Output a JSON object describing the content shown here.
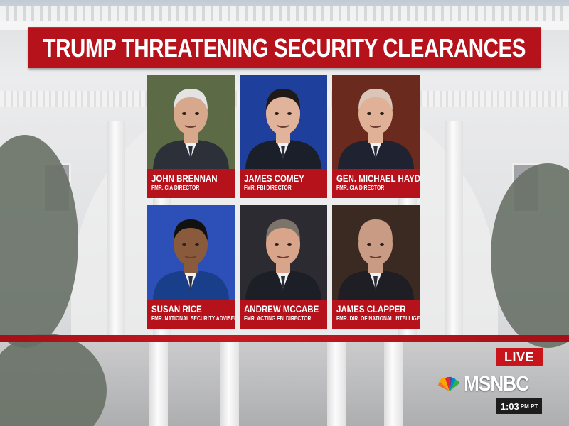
{
  "banner": {
    "headline": "TRUMP THREATENING SECURITY CLEARANCES"
  },
  "cards": [
    {
      "name": "JOHN BRENNAN",
      "title": "FMR. CIA DIRECTOR",
      "bg": "#5c6b45",
      "suit": "#2c3038",
      "skin": "#d7a88c",
      "hair": "#e3e3e3"
    },
    {
      "name": "JAMES COMEY",
      "title": "FMR. FBI DIRECTOR",
      "bg": "#1e3f9c",
      "suit": "#1b1f2a",
      "skin": "#e2b39b",
      "hair": "#1f1a18"
    },
    {
      "name": "GEN. MICHAEL HAYDEN",
      "title": "FMR. CIA DIRECTOR",
      "bg": "#6a2a1d",
      "suit": "#1f2230",
      "skin": "#e0b197",
      "hair": "#d9c6b8"
    },
    {
      "name": "SUSAN RICE",
      "title": "FMR. NATIONAL SECURITY ADVISER",
      "bg": "#2d4fb8",
      "suit": "#1a3f8a",
      "skin": "#8a5a3d",
      "hair": "#111111"
    },
    {
      "name": "ANDREW MCCABE",
      "title": "FMR. ACTING FBI DIRECTOR",
      "bg": "#2b2b31",
      "suit": "#1c1f26",
      "skin": "#d8a58b",
      "hair": "#7c736b"
    },
    {
      "name": "JAMES CLAPPER",
      "title": "FMR. DIR. OF NATIONAL INTELLIGENCE",
      "bg": "#3a2a22",
      "suit": "#1e1e24",
      "skin": "#c99b84",
      "hair": "#c99b84"
    }
  ],
  "bug": {
    "live": "LIVE",
    "network": "MSNBC",
    "time": "1:03",
    "zone": "PM PT"
  }
}
